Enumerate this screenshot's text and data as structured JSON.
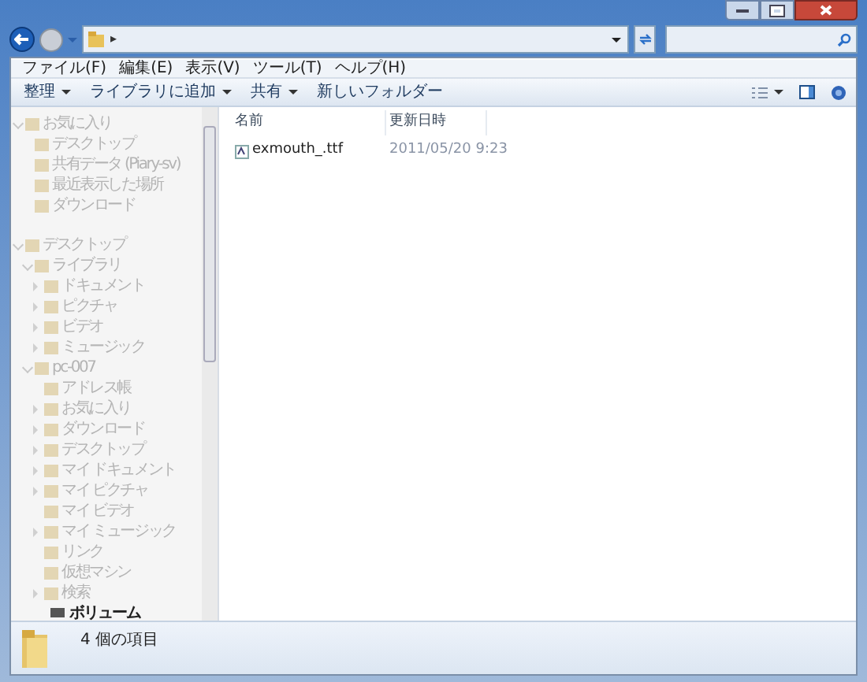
{
  "address": {
    "path_separator": "▸"
  },
  "menu": [
    {
      "label": "ファイル(F)"
    },
    {
      "label": "編集(E)"
    },
    {
      "label": "表示(V)"
    },
    {
      "label": "ツール(T)"
    },
    {
      "label": "ヘルプ(H)"
    }
  ],
  "toolbar": [
    {
      "label": "整理",
      "dropdown": true
    },
    {
      "label": "ライブラリに追加",
      "dropdown": true
    },
    {
      "label": "共有",
      "dropdown": true
    },
    {
      "label": "新しいフォルダー",
      "dropdown": false
    }
  ],
  "nav_tree": [
    {
      "label": "お気に入り",
      "expanded": true,
      "children": [
        {
          "label": "デスクトップ"
        },
        {
          "label": "共有データ (Piary-sv)"
        },
        {
          "label": "最近表示した場所"
        },
        {
          "label": "ダウンロード"
        }
      ]
    },
    {
      "label": "デスクトップ",
      "expanded": true,
      "children": [
        {
          "label": "ライブラリ",
          "expanded": true,
          "children": [
            {
              "label": "ドキュメント",
              "expanded": false
            },
            {
              "label": "ピクチャ",
              "expanded": false
            },
            {
              "label": "ビデオ",
              "expanded": false
            },
            {
              "label": "ミュージック",
              "expanded": false
            }
          ]
        },
        {
          "label": "pc-007",
          "expanded": true,
          "children": [
            {
              "label": "アドレス帳"
            },
            {
              "label": "お気に入り",
              "expanded": false
            },
            {
              "label": "ダウンロード",
              "expanded": false
            },
            {
              "label": "デスクトップ",
              "expanded": false
            },
            {
              "label": "マイ ドキュメント",
              "expanded": false
            },
            {
              "label": "マイ ピクチャ",
              "expanded": false
            },
            {
              "label": "マイ ビデオ"
            },
            {
              "label": "マイ ミュージック",
              "expanded": false
            },
            {
              "label": "リンク"
            },
            {
              "label": "仮想マシン"
            },
            {
              "label": "検索",
              "expanded": false
            }
          ]
        }
      ]
    }
  ],
  "nav_partial": {
    "label": "ボリューム"
  },
  "columns": [
    {
      "label": "名前"
    },
    {
      "label": "更新日時"
    }
  ],
  "files": [
    {
      "name": "exmouth_.ttf",
      "modified": "2011/05/20 9:23"
    }
  ],
  "status": {
    "text": "4 個の項目"
  }
}
